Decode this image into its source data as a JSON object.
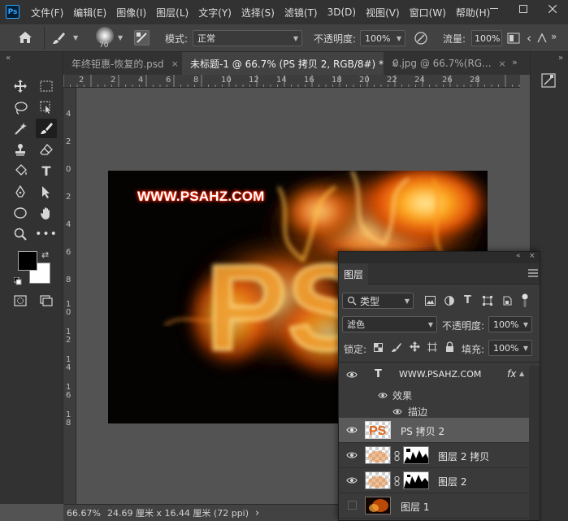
{
  "app": {
    "logo_text": "Ps"
  },
  "menu": [
    "文件(F)",
    "编辑(E)",
    "图像(I)",
    "图层(L)",
    "文字(Y)",
    "选择(S)",
    "滤镜(T)",
    "3D(D)",
    "视图(V)",
    "窗口(W)",
    "帮助(H)"
  ],
  "options_bar": {
    "brush_size": "70",
    "mode_label": "模式:",
    "mode_value": "正常",
    "opacity_label": "不透明度:",
    "opacity_value": "100%",
    "flow_label": "流量:",
    "flow_value": "100%"
  },
  "tabs": [
    {
      "label": "年终钜惠-恢复的.psd",
      "close": "×"
    },
    {
      "label": "未标题-1 @ 66.7% (PS 拷贝 2, RGB/8#) *",
      "close": "×"
    },
    {
      "label": "0.jpg @ 66.7%(RG...",
      "close": "×"
    }
  ],
  "ruler_top": [
    "2",
    "2",
    "4",
    "6",
    "8",
    "10",
    "12",
    "14",
    "16",
    "18",
    "20",
    "22",
    "24",
    "26",
    "28"
  ],
  "ruler_left": [
    "4",
    "2",
    "0",
    "2",
    "4",
    "6",
    "8",
    "1\n0",
    "1\n2",
    "1\n4",
    "1\n6",
    "1\n8"
  ],
  "canvas": {
    "watermark": "WWW.PSAHZ.COM",
    "fire_text": "PS"
  },
  "status": {
    "zoom": "66.67%",
    "doc_info": "24.69 厘米 x 16.44 厘米 (72 ppi)",
    "arrow": "›"
  },
  "layers_panel": {
    "title": "图层",
    "filter_kind": "类型",
    "blend_mode": "滤色",
    "opacity_label": "不透明度:",
    "opacity_value": "100%",
    "lock_label": "锁定:",
    "fill_label": "填充:",
    "fill_value": "100%",
    "text_layer": {
      "name": "WWW.PSAHZ.COM",
      "type_glyph": "T",
      "fx": "fx"
    },
    "effects_label": "效果",
    "stroke_label": "描边",
    "layers": [
      {
        "name": "PS 拷贝 2",
        "selected": true
      },
      {
        "name": "图层 2 拷贝",
        "selected": false
      },
      {
        "name": "图层 2",
        "selected": false
      },
      {
        "name": "图层 1",
        "selected": false
      }
    ]
  },
  "colors": {
    "foreground": "#000000",
    "background": "#ffffff",
    "accent": "#31a8ff"
  }
}
